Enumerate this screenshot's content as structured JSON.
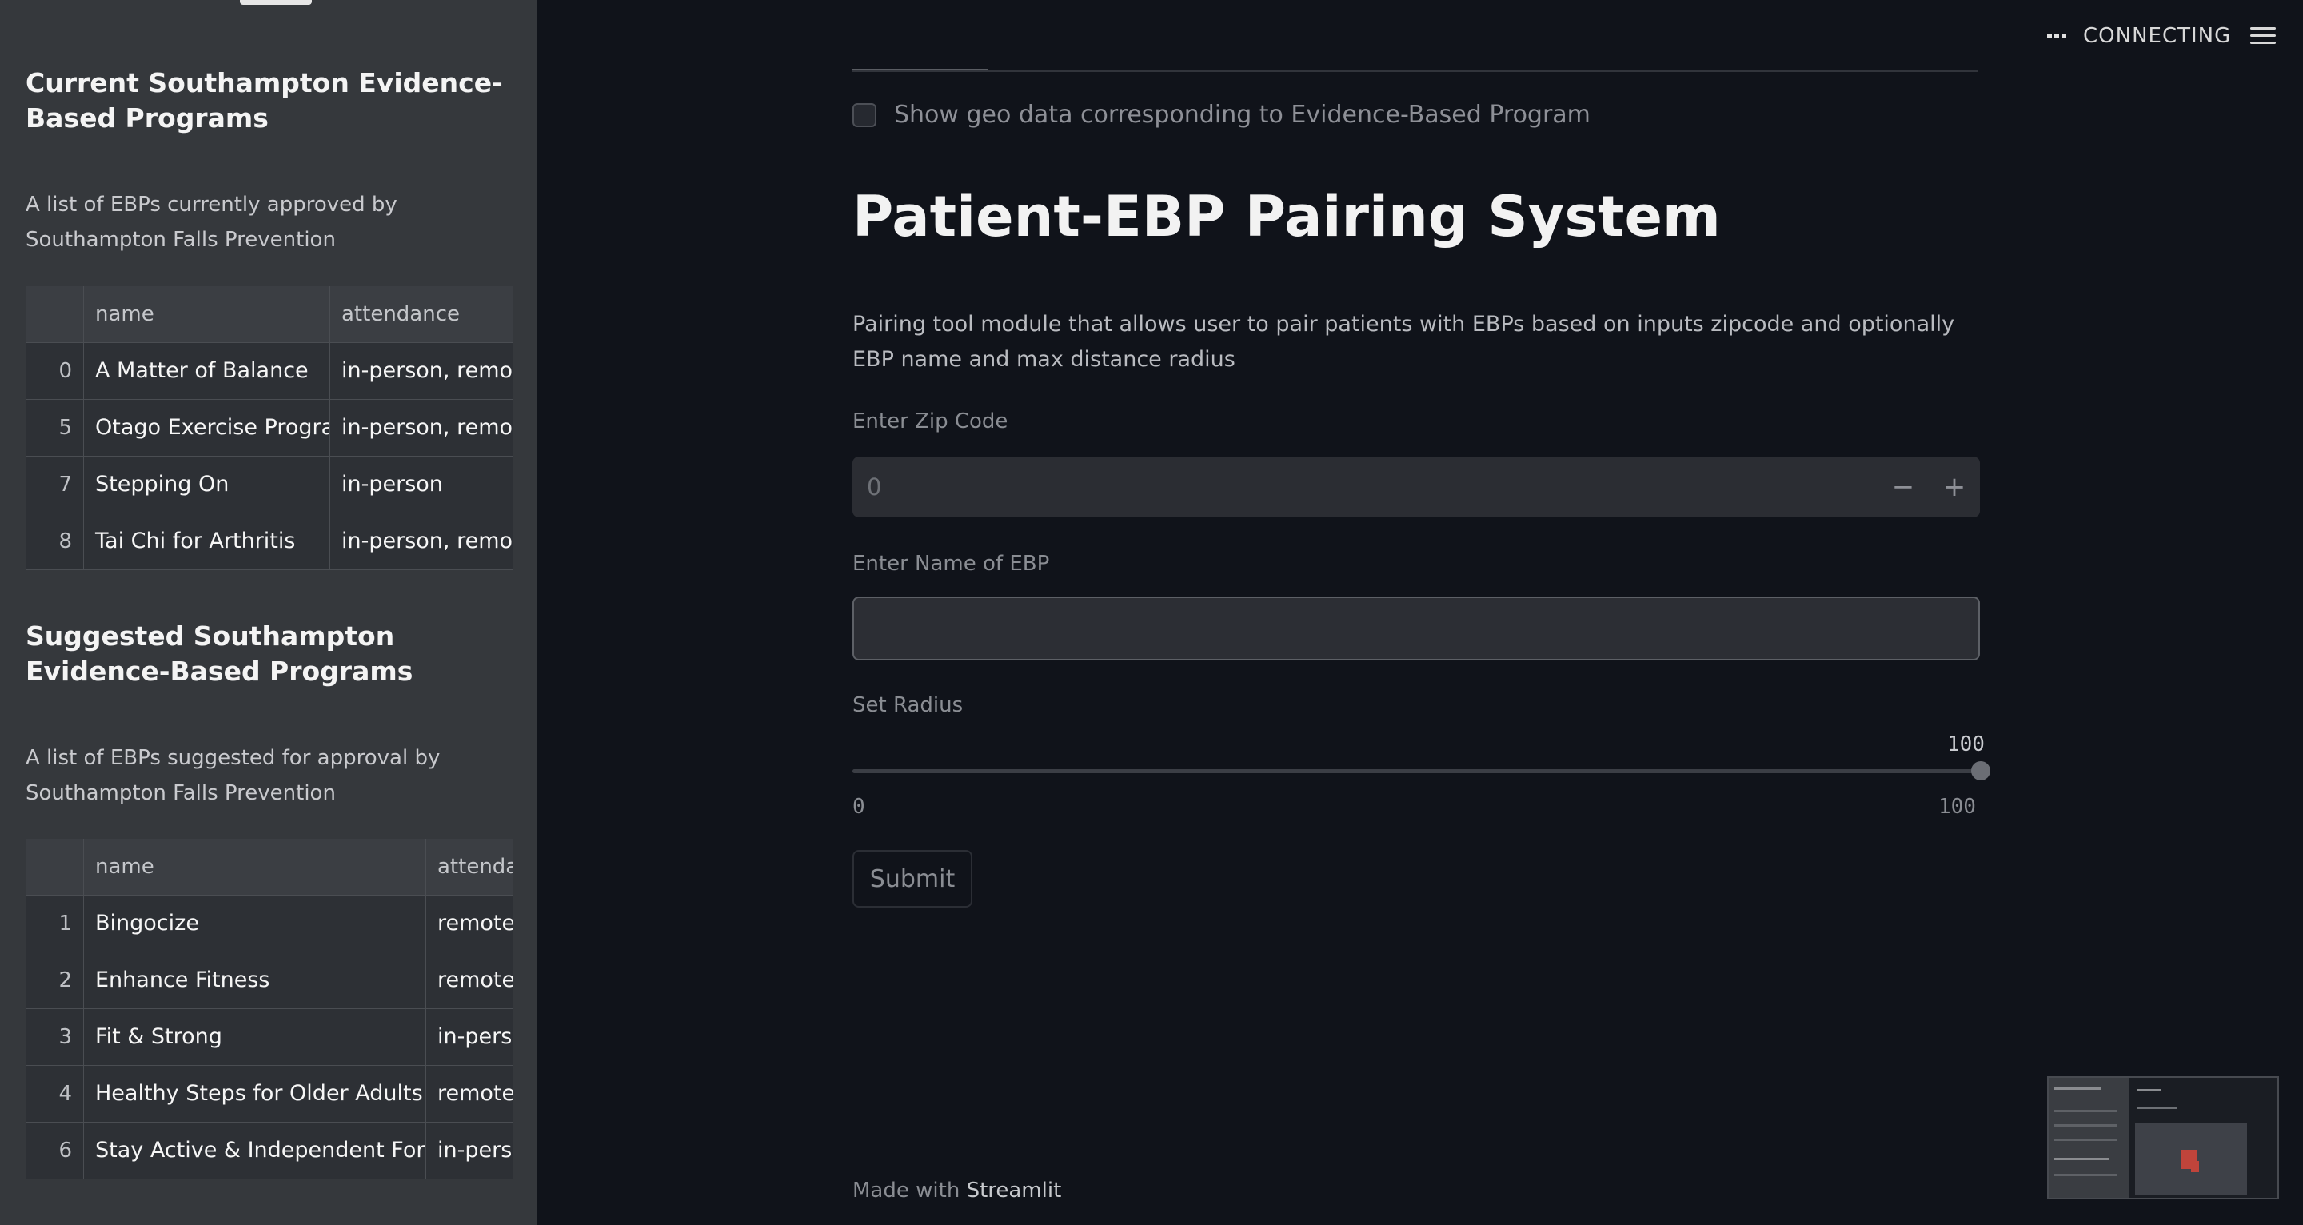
{
  "sidebar": {
    "current": {
      "title": "Current Southampton Evidence-Based Programs",
      "description": "A list of EBPs currently approved by Southampton Falls Prevention",
      "columns": [
        "",
        "name",
        "attendance"
      ],
      "rows": [
        {
          "idx": "0",
          "name": "A Matter of Balance",
          "attendance": "in-person, remote"
        },
        {
          "idx": "5",
          "name": "Otago Exercise Program",
          "attendance": "in-person, remote"
        },
        {
          "idx": "7",
          "name": "Stepping On",
          "attendance": "in-person"
        },
        {
          "idx": "8",
          "name": "Tai Chi for Arthritis",
          "attendance": "in-person, remote"
        }
      ]
    },
    "suggested": {
      "title": "Suggested Southampton Evidence-Based Programs",
      "description": "A list of EBPs suggested for approval by Southampton Falls Prevention",
      "columns": [
        "",
        "name",
        "attendance"
      ],
      "rows": [
        {
          "idx": "1",
          "name": "Bingocize",
          "attendance": "remote"
        },
        {
          "idx": "2",
          "name": "Enhance Fitness",
          "attendance": "remote"
        },
        {
          "idx": "3",
          "name": "Fit & Strong",
          "attendance": "in-person"
        },
        {
          "idx": "4",
          "name": "Healthy Steps for Older Adults",
          "attendance": "remote"
        },
        {
          "idx": "6",
          "name": "Stay Active & Independent For Life",
          "attendance": "in-person"
        }
      ]
    }
  },
  "main": {
    "checkbox_label": "Show geo data corresponding to Evidence-Based Program",
    "title": "Patient-EBP Pairing System",
    "description": "Pairing tool module that allows user to pair patients with EBPs based on inputs zipcode and optionally EBP name and max distance radius",
    "zip": {
      "label": "Enter Zip Code",
      "value": "0",
      "minus": "−",
      "plus": "+"
    },
    "ebp_name": {
      "label": "Enter Name of EBP",
      "value": ""
    },
    "radius": {
      "label": "Set Radius",
      "value": "100",
      "min": "0",
      "max": "100",
      "fraction": 1.0
    },
    "submit_label": "Submit",
    "footer_prefix": "Made with",
    "footer_brand": "Streamlit"
  },
  "header": {
    "status": "CONNECTING",
    "menu_icon": "hamburger-menu-icon"
  },
  "colors": {
    "sidebar_bg": "#35383c",
    "main_bg": "#10131a",
    "table_bg": "#2d3035"
  }
}
